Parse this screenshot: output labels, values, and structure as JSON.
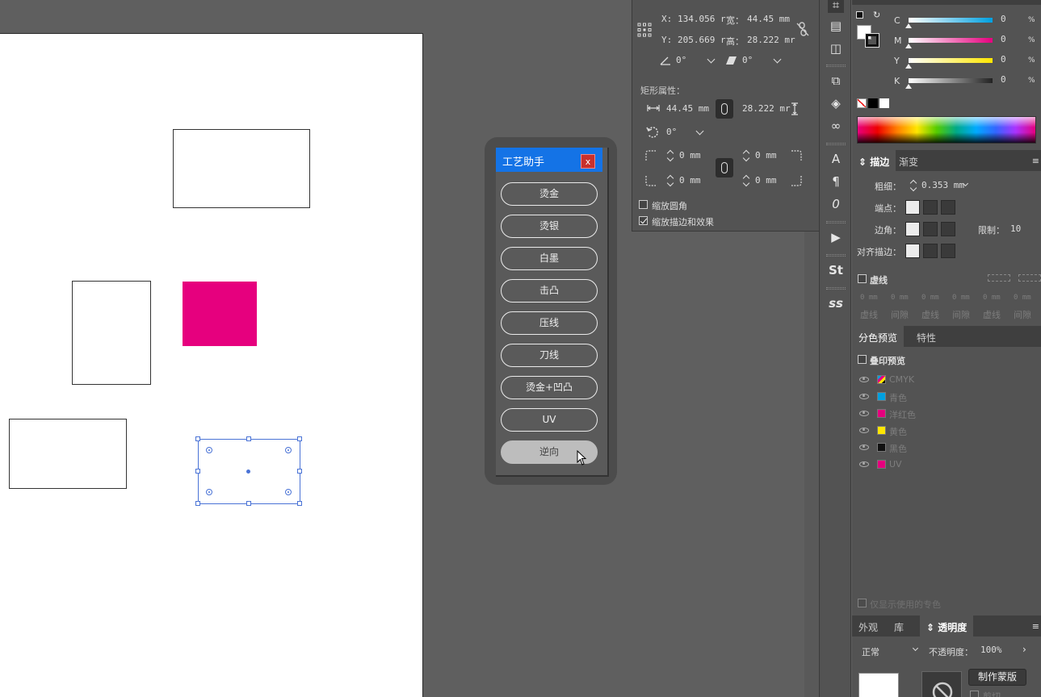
{
  "helper": {
    "title": "工艺助手",
    "close": "x",
    "buttons": [
      "烫金",
      "烫银",
      "白墨",
      "击凸",
      "压线",
      "刀线",
      "烫金+凹凸",
      "UV",
      "逆向"
    ],
    "active_index": 8
  },
  "transform": {
    "x_label": "X:",
    "x_value": "134.056 r",
    "w_label": "宽：",
    "w_value": "44.45 mm",
    "y_label": "Y:",
    "y_value": "205.669 r",
    "h_label": "高：",
    "h_value": "28.222 mr",
    "rotate": "0°",
    "shear": "0°",
    "rect_props_title": "矩形属性：",
    "rect_w": "44.45 mm",
    "rect_h": "28.222 mr",
    "rect_rotate": "0°",
    "corner_tl": "0 mm",
    "corner_tr": "0 mm",
    "corner_bl": "0 mm",
    "corner_br": "0 mm",
    "scale_corners": "缩放圆角",
    "scale_corners_checked": false,
    "scale_strokes": "缩放描边和效果",
    "scale_strokes_checked": true
  },
  "color": {
    "channels": [
      {
        "name": "C",
        "value": "0",
        "unit": "%"
      },
      {
        "name": "M",
        "value": "0",
        "unit": "%"
      },
      {
        "name": "Y",
        "value": "0",
        "unit": "%"
      },
      {
        "name": "K",
        "value": "0",
        "unit": "%"
      }
    ]
  },
  "stroke": {
    "tabs": [
      "描边",
      "渐变"
    ],
    "weight_label": "粗细：",
    "weight_value": "0.353 mm",
    "cap_label": "端点：",
    "corner_label": "边角：",
    "limit_label": "限制：",
    "limit_value": "10",
    "align_label": "对齐描边：",
    "dashed_label": "虚线",
    "dash_fields": [
      "0 mm",
      "0 mm",
      "0 mm",
      "0 mm",
      "0 mm",
      "0 mm"
    ],
    "dash_labels": [
      "虚线",
      "间隙",
      "虚线",
      "间隙",
      "虚线",
      "间隙"
    ]
  },
  "separations": {
    "tabs": [
      "分色预览",
      "特性"
    ],
    "overprint_label": "叠印预览",
    "inks": [
      {
        "name": "CMYK",
        "color": "#8a8a8a"
      },
      {
        "name": "青色",
        "color": "#00a0e0"
      },
      {
        "name": "洋红色",
        "color": "#e6007e"
      },
      {
        "name": "黄色",
        "color": "#ffe600"
      },
      {
        "name": "黑色",
        "color": "#111111"
      },
      {
        "name": "UV",
        "color": "#e6007e"
      }
    ],
    "spot_only": "仅显示使用的专色"
  },
  "transparency": {
    "tabs": [
      "外观",
      "库",
      "透明度"
    ],
    "mode": "正常",
    "opacity_label": "不透明度：",
    "opacity_value": "100%",
    "make_mask": "制作蒙版",
    "clip": "剪切"
  },
  "colors": {
    "accent": "#1473e6",
    "magenta": "#e6007e",
    "selection": "#4a73d6",
    "close": "#c9302c"
  }
}
